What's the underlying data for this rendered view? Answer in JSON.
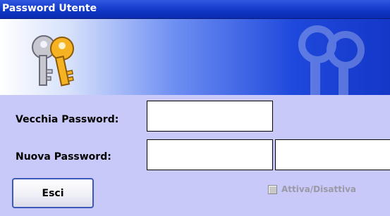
{
  "window": {
    "title": "Password Utente"
  },
  "banner": {
    "icon": "keys-icon",
    "watermark_icon": "keys-icon"
  },
  "form": {
    "old_password": {
      "label": "Vecchia Password:",
      "value": ""
    },
    "new_password": {
      "label": "Nuova Password:",
      "value": "",
      "confirm_value": ""
    }
  },
  "actions": {
    "exit_label": "Esci",
    "toggle_label": "Attiva/Disattiva",
    "toggle_checked": false,
    "toggle_enabled": false
  },
  "colors": {
    "title_bar": "#1238c8",
    "window_background": "#c9c9f9",
    "button_border": "#3b59b9",
    "disabled_text": "#9a9aa6"
  }
}
